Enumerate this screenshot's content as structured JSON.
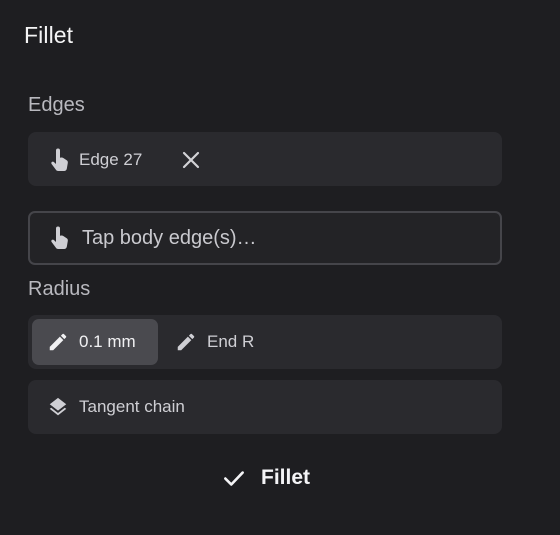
{
  "panel": {
    "title": "Fillet"
  },
  "edges": {
    "label": "Edges",
    "selected_edge": "Edge 27",
    "input_placeholder": "Tap body edge(s)…"
  },
  "radius": {
    "label": "Radius",
    "value": "0.1 mm",
    "end_radius_label": "End R"
  },
  "options": {
    "tangent_chain_label": "Tangent chain"
  },
  "actions": {
    "confirm_label": "Fillet"
  },
  "icons": {
    "tap": "tap-hand-icon",
    "remove": "close-icon",
    "edit": "pencil-icon",
    "layers": "layers-icon",
    "confirm": "checkmark-icon"
  }
}
